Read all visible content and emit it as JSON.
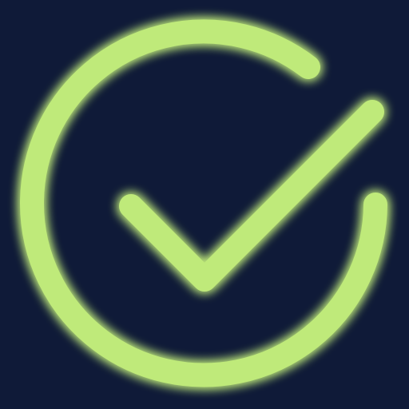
{
  "icon": {
    "name": "check-circle-icon",
    "colors": {
      "background": "#0f1a38",
      "stroke": "#bfea7a",
      "glow": "#a8ea5c"
    }
  }
}
